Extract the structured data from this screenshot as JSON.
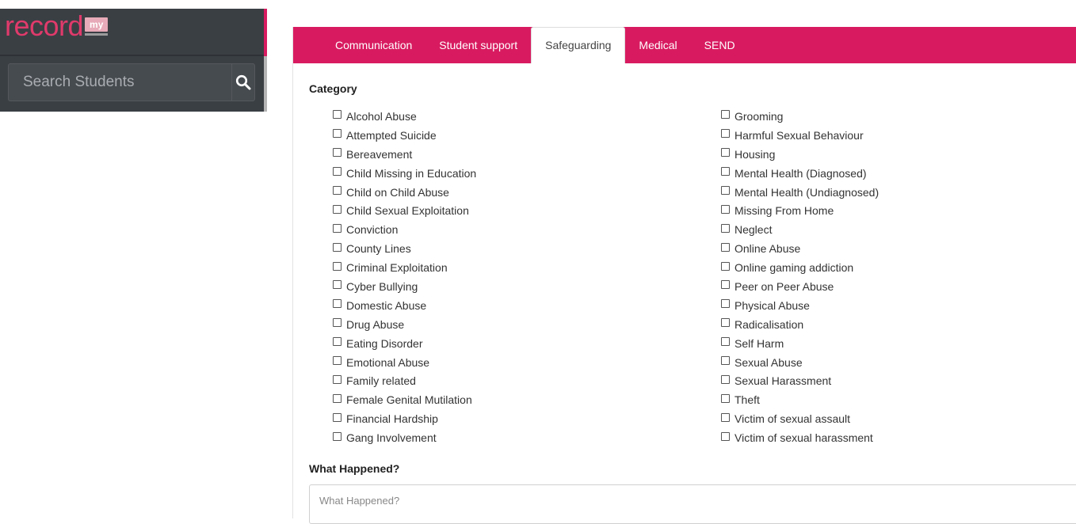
{
  "brand": {
    "word": "record",
    "badge": "my"
  },
  "search": {
    "placeholder": "Search Students"
  },
  "tabs": [
    {
      "label": "Communication",
      "active": false
    },
    {
      "label": "Student support",
      "active": false
    },
    {
      "label": "Safeguarding",
      "active": true
    },
    {
      "label": "Medical",
      "active": false
    },
    {
      "label": "SEND",
      "active": false
    }
  ],
  "category": {
    "label": "Category",
    "left": [
      "Alcohol Abuse",
      "Attempted Suicide",
      "Bereavement",
      "Child Missing in Education",
      "Child on Child Abuse",
      "Child Sexual Exploitation",
      "Conviction",
      "County Lines",
      "Criminal Exploitation",
      "Cyber Bullying",
      "Domestic Abuse",
      "Drug Abuse",
      "Eating Disorder",
      "Emotional Abuse",
      "Family related",
      "Female Genital Mutilation",
      "Financial Hardship",
      "Gang Involvement"
    ],
    "right": [
      "Grooming",
      "Harmful Sexual Behaviour",
      "Housing",
      "Mental Health (Diagnosed)",
      "Mental Health (Undiagnosed)",
      "Missing From Home",
      "Neglect",
      "Online Abuse",
      "Online gaming addiction",
      "Peer on Peer Abuse",
      "Physical Abuse",
      "Radicalisation",
      "Self Harm",
      "Sexual Abuse",
      "Sexual Harassment",
      "Theft",
      "Victim of sexual assault",
      "Victim of sexual harassment"
    ]
  },
  "what_happened": {
    "label": "What Happened?",
    "placeholder": "What Happened?",
    "value": ""
  },
  "colors": {
    "accent": "#d81b60",
    "panel": "#3a3f44"
  }
}
